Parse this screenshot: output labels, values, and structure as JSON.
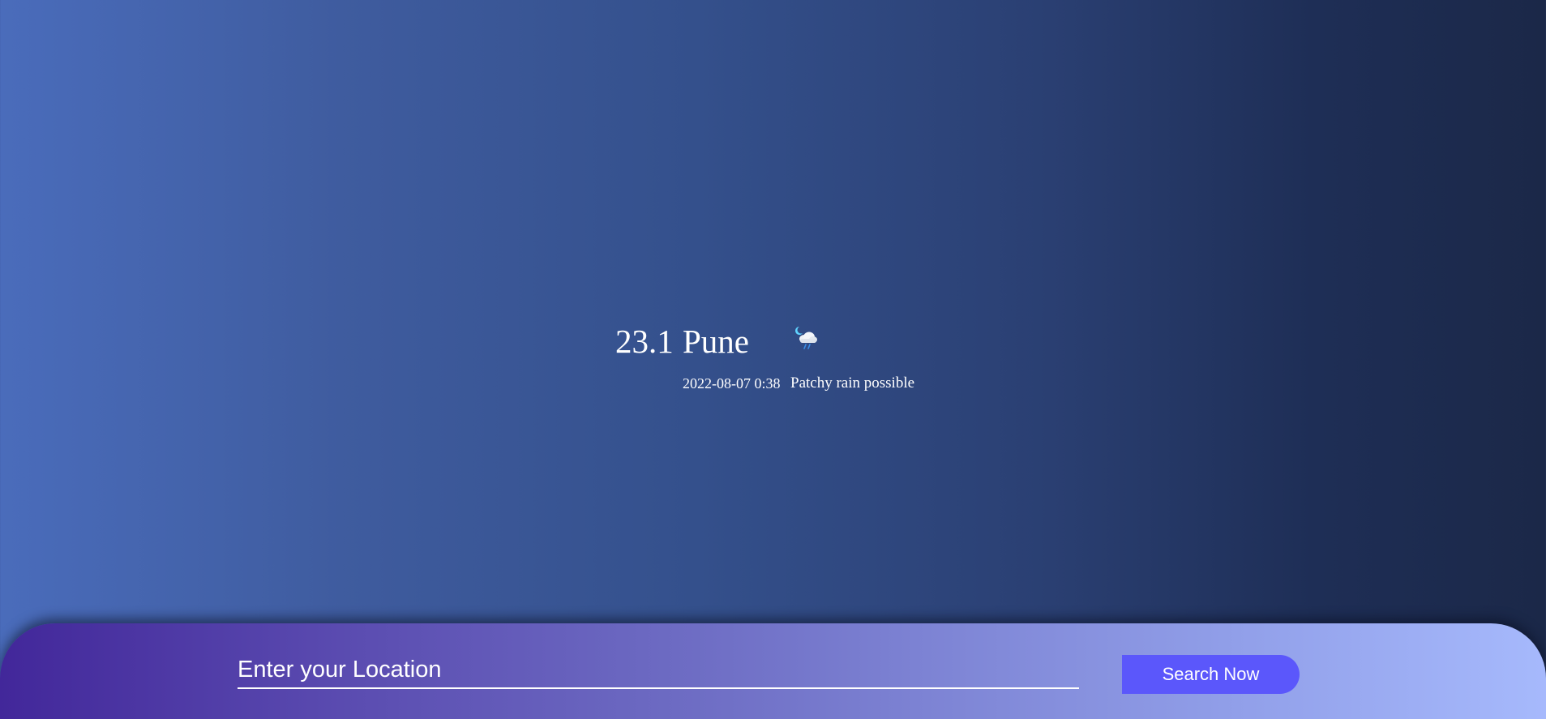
{
  "weather": {
    "temperature": "23.1",
    "city": "Pune",
    "datetime": "2022-08-07 0:38",
    "condition": "Patchy rain possible",
    "icon": "night-rain-cloud-icon"
  },
  "search": {
    "placeholder": "Enter your Location",
    "button_label": "Search Now"
  },
  "colors": {
    "background_gradient": [
      "#4a6cbb",
      "#1b2848"
    ],
    "panel_gradient": [
      "#42279a",
      "#a6b9fc"
    ],
    "button": "#5b57fb"
  }
}
